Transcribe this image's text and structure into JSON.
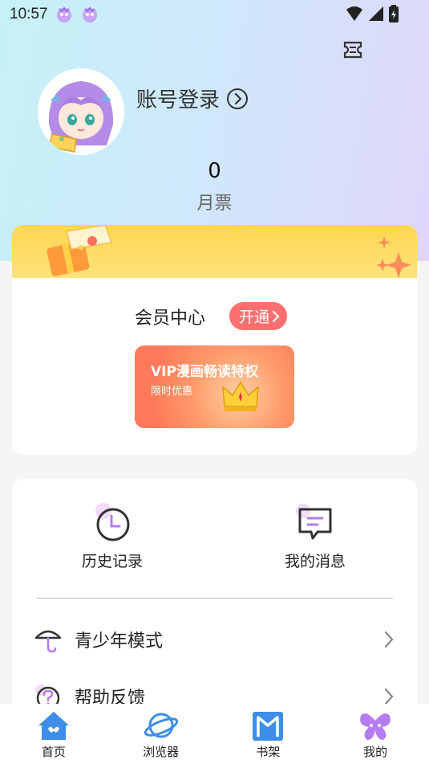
{
  "status_bar": {
    "time": "10:57"
  },
  "profile": {
    "login_label": "账号登录",
    "monthly_ticket_value": "0",
    "monthly_ticket_label": "月票"
  },
  "vip": {
    "title": "会员中心",
    "open_label": "开通",
    "promo_title": "VIP漫画畅读特权",
    "promo_subtitle": "限时优惠"
  },
  "quick_actions": [
    {
      "label": "历史记录",
      "icon": "clock-icon"
    },
    {
      "label": "我的消息",
      "icon": "message-icon"
    }
  ],
  "menu": [
    {
      "label": "青少年模式",
      "icon": "umbrella-icon"
    },
    {
      "label": "帮助反馈",
      "icon": "help-icon"
    }
  ],
  "tabs": [
    {
      "label": "首页",
      "icon": "home-icon"
    },
    {
      "label": "浏览器",
      "icon": "planet-icon"
    },
    {
      "label": "书架",
      "icon": "bookshelf-icon"
    },
    {
      "label": "我的",
      "icon": "butterfly-icon"
    }
  ],
  "colors": {
    "accent_red": "#ff6f6f",
    "vip_yellow": "#ffd64f",
    "icon_purple": "#b47cf0",
    "tab_blue": "#3d8ee8"
  }
}
